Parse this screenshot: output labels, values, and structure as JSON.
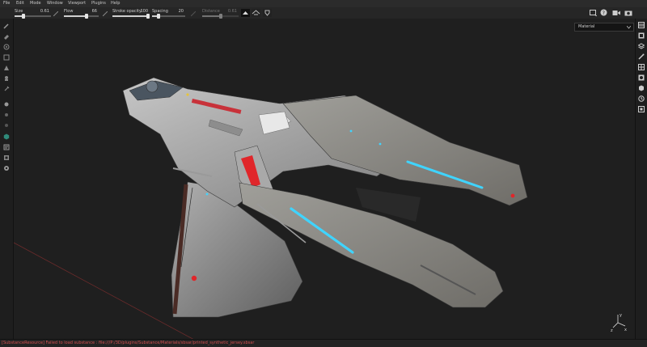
{
  "menu": [
    "File",
    "Edit",
    "Mode",
    "Window",
    "Viewport",
    "Plugins",
    "Help"
  ],
  "toolbar": {
    "size": {
      "label": "Size",
      "value": "0.61",
      "level": 0.25
    },
    "flow": {
      "label": "Flow",
      "value": "66",
      "level": 0.66
    },
    "stroke_opacity": {
      "label": "Stroke opacity",
      "value": "100",
      "level": 1.0
    },
    "spacing": {
      "label": "Spacing",
      "value": "20",
      "level": 0.2
    },
    "distance": {
      "label": "Distance",
      "value": "0.61",
      "level": 0.5
    }
  },
  "material_select": {
    "value": "Material"
  },
  "status": {
    "text": "[SubstanceResource] Failed to load substance : file:///P:/3D/plugins/Substance/Materials/sbsar/printed_synthetic_jersey.sbsar"
  },
  "axis_gizmo": {
    "x": "x",
    "y": "y",
    "z": "z"
  },
  "colors": {
    "accent_blue": "#3fd4ff",
    "accent_red": "#e0262a",
    "status_error": "#d25050"
  }
}
